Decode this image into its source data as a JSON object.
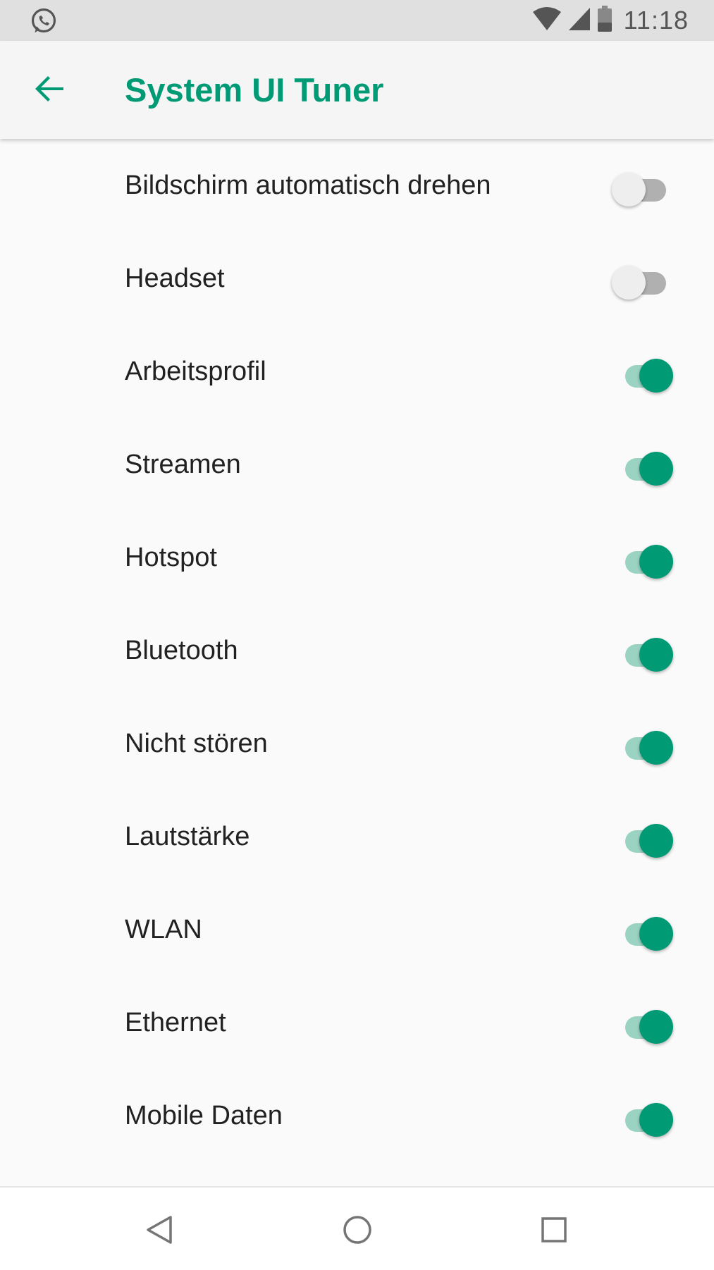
{
  "status_bar": {
    "left_icon": "whatsapp-icon",
    "time": "11:18",
    "icons": [
      "wifi-icon",
      "cellular-signal-icon",
      "battery-icon"
    ]
  },
  "app_bar": {
    "back_icon": "arrow-back-icon",
    "title": "System UI Tuner"
  },
  "colors": {
    "accent": "#009a74",
    "accent_track": "#9bd3c3",
    "off_track": "#b0b0b0",
    "off_thumb": "#eeeeee",
    "text": "#212121",
    "background": "#fafafa"
  },
  "settings": [
    {
      "label": "Bildschirm automatisch drehen",
      "on": false
    },
    {
      "label": "Headset",
      "on": false
    },
    {
      "label": "Arbeitsprofil",
      "on": true
    },
    {
      "label": "Streamen",
      "on": true
    },
    {
      "label": "Hotspot",
      "on": true
    },
    {
      "label": "Bluetooth",
      "on": true
    },
    {
      "label": "Nicht stören",
      "on": true
    },
    {
      "label": "Lautstärke",
      "on": true
    },
    {
      "label": "WLAN",
      "on": true
    },
    {
      "label": "Ethernet",
      "on": true
    },
    {
      "label": "Mobile Daten",
      "on": true
    }
  ],
  "nav_bar": {
    "back": "nav-back-icon",
    "home": "nav-home-icon",
    "recents": "nav-recents-icon"
  }
}
